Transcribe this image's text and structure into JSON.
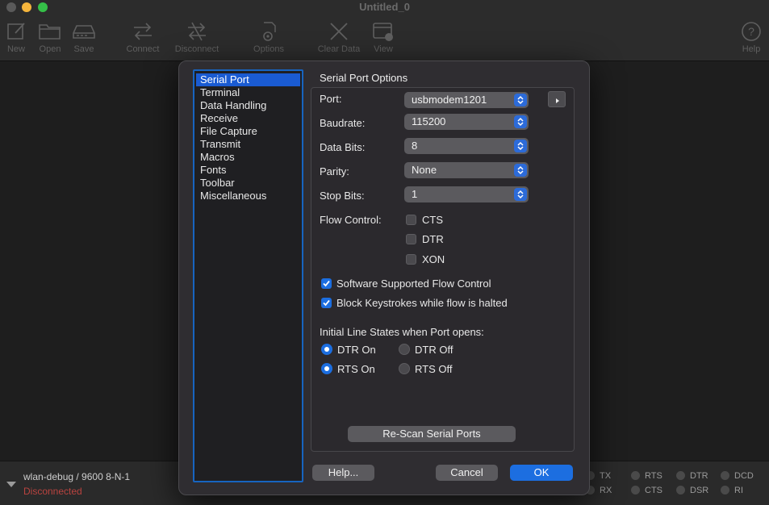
{
  "window": {
    "title": "Untitled_0"
  },
  "toolbar": {
    "new": "New",
    "open": "Open",
    "save": "Save",
    "connect": "Connect",
    "disconnect": "Disconnect",
    "options": "Options",
    "clear_data": "Clear Data",
    "view": "View",
    "help": "Help"
  },
  "statusbar": {
    "connection": "wlan-debug / 9600 8-N-1",
    "state": "Disconnected",
    "lines": {
      "tx": "TX",
      "rx": "RX",
      "rts": "RTS",
      "cts": "CTS",
      "dtr": "DTR",
      "dsr": "DSR",
      "dcd": "DCD",
      "ri": "RI"
    }
  },
  "dialog": {
    "categories": [
      "Serial Port",
      "Terminal",
      "Data Handling",
      "Receive",
      "File Capture",
      "Transmit",
      "Macros",
      "Fonts",
      "Toolbar",
      "Miscellaneous"
    ],
    "selected_category": "Serial Port",
    "group_title": "Serial Port Options",
    "fields": {
      "port": {
        "label": "Port:",
        "value": "usbmodem1201"
      },
      "baudrate": {
        "label": "Baudrate:",
        "value": "115200"
      },
      "data_bits": {
        "label": "Data Bits:",
        "value": "8"
      },
      "parity": {
        "label": "Parity:",
        "value": "None"
      },
      "stop_bits": {
        "label": "Stop Bits:",
        "value": "1"
      }
    },
    "flow_control": {
      "label": "Flow Control:",
      "cts": {
        "label": "CTS",
        "checked": false
      },
      "dtr": {
        "label": "DTR",
        "checked": false
      },
      "xon": {
        "label": "XON",
        "checked": false
      }
    },
    "software_flow": {
      "label": "Software Supported Flow Control",
      "checked": true
    },
    "block_keystrokes": {
      "label": "Block Keystrokes while flow is halted",
      "checked": true
    },
    "line_states": {
      "label": "Initial Line States when Port opens:",
      "dtr_on": "DTR On",
      "dtr_off": "DTR Off",
      "rts_on": "RTS On",
      "rts_off": "RTS Off",
      "dtr_selected": "DTR On",
      "rts_selected": "RTS On"
    },
    "rescan_label": "Re-Scan Serial Ports",
    "help_label": "Help...",
    "cancel_label": "Cancel",
    "ok_label": "OK"
  },
  "colors": {
    "accent": "#1c6ee0",
    "selection": "#1a5bd2",
    "disconnected": "#b9433f"
  }
}
